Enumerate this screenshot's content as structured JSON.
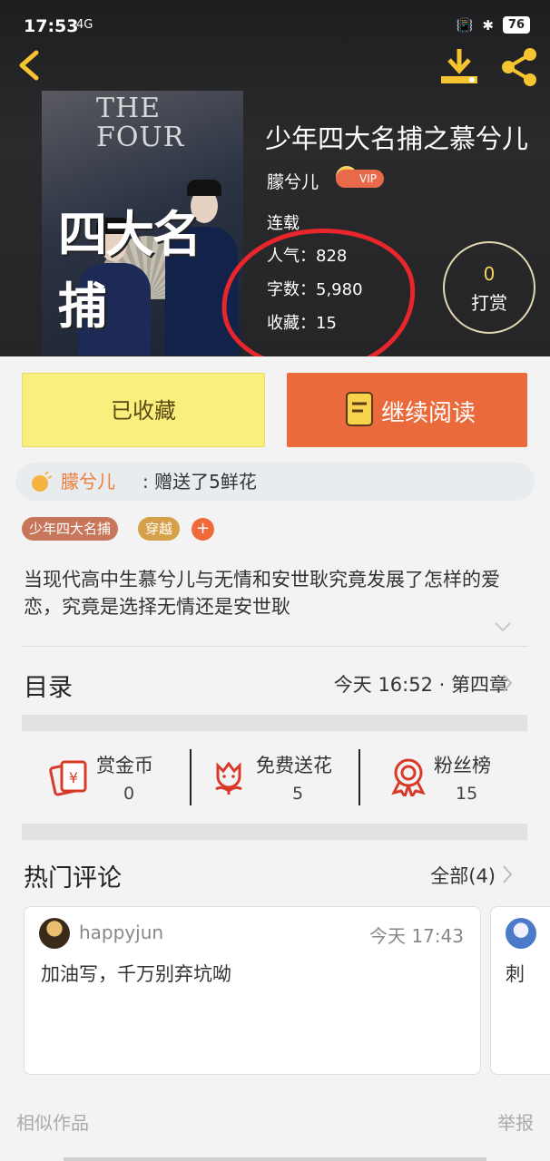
{
  "status_bar": {
    "time": "17:53",
    "network": "4G",
    "battery": "76"
  },
  "header": {
    "back_icon": "chevron-left-icon",
    "download_icon": "download-icon",
    "share_icon": "share-icon"
  },
  "cover": {
    "title_en": "THE FOUR",
    "title_cn": "四大名捕"
  },
  "book": {
    "title": "少年四大名捕之慕兮儿",
    "author": "朦兮儿",
    "badge": "VIP",
    "status": "连载",
    "popularity": "人气：828",
    "words": "字数：5,980",
    "favorites": "收藏：15"
  },
  "tip": {
    "count": "0",
    "label": "打赏"
  },
  "actions": {
    "fav_label": "已收藏",
    "read_label": "继续阅读"
  },
  "flower_note": {
    "who": "朦兮儿",
    "message": ": 赠送了5鲜花"
  },
  "tags": [
    "少年四大名捕",
    "穿越"
  ],
  "tag_add": "+",
  "description": "当现代高中生慕兮儿与无情和安世耿究竟发展了怎样的爱恋，究竟是选择无情还是安世耿",
  "toc": {
    "label": "目录",
    "latest": "今天 16:52 · 第四章"
  },
  "rewards": [
    {
      "label": "赏金币",
      "value": "0",
      "icon": "red-envelope-icon"
    },
    {
      "label": "免费送花",
      "value": "5",
      "icon": "flower-icon"
    },
    {
      "label": "粉丝榜",
      "value": "15",
      "icon": "medal-icon"
    }
  ],
  "comments": {
    "label": "热门评论",
    "all": "全部(4)",
    "items": [
      {
        "user": "happyjun",
        "time": "今天 17:43",
        "text": "加油写，千万别弃坑呦"
      },
      {
        "user": "",
        "time": "",
        "text": "刺"
      }
    ]
  },
  "footer": {
    "similar": "相似作品",
    "report": "举报"
  },
  "colors": {
    "accent_orange": "#ea6a3c",
    "fav_yellow": "#f8ef7c",
    "annotation_red": "#e8262c"
  }
}
